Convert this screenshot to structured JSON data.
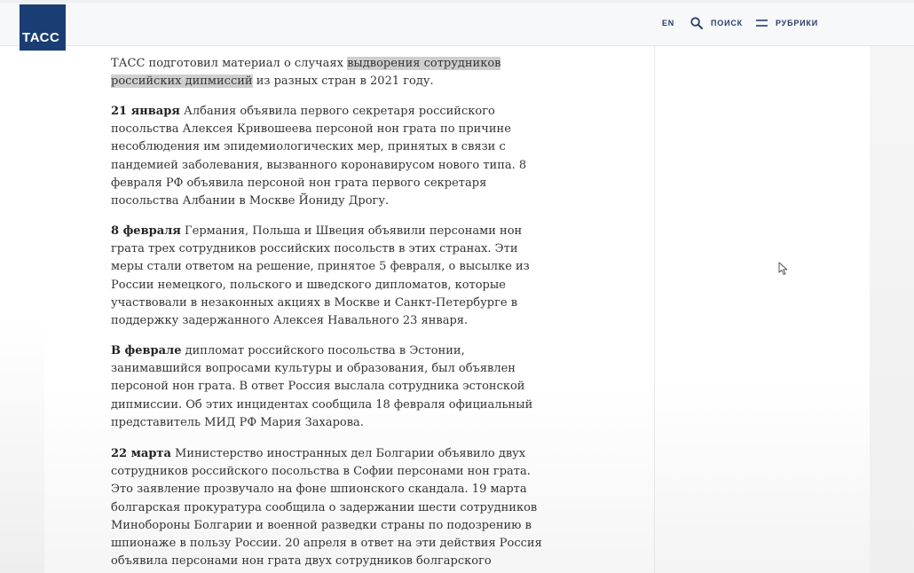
{
  "header": {
    "logo_text": "ТАСС",
    "nav": {
      "lang": "EN",
      "search_label": "ПОИСК",
      "rubrics_label": "РУБРИКИ"
    }
  },
  "article": {
    "intro": {
      "before": "ТАСС подготовил материал о случаях ",
      "highlight": "выдворения сотрудников российских дипмиссий",
      "after": " из разных стран в 2021 году."
    },
    "paragraphs": [
      {
        "date": "21 января",
        "text": " Албания объявила первого секретаря российского посольства Алексея Кривошеева персоной нон грата по причине несоблюдения им эпидемиологических мер, принятых в связи с пандемией заболевания, вызванного коронавирусом нового типа. 8 февраля РФ объявила персоной нон грата первого секретаря посольства Албании в Москве Йониду Дрогу."
      },
      {
        "date": "8 февраля",
        "text": " Германия, Польша и Швеция объявили персонами нон грата трех сотрудников российских посольств в этих странах. Эти меры стали ответом на решение, принятое 5 февраля, о высылке из России немецкого, польского и шведского дипломатов, которые участвовали в незаконных акциях в Москве и Санкт-Петербурге в поддержку задержанного Алексея Навального 23 января."
      },
      {
        "date": "В феврале",
        "text": " дипломат российского посольства в Эстонии, занимавшийся вопросами культуры и образования, был объявлен персоной нон грата. В ответ Россия выслала сотрудника эстонской дипмиссии. Об этих инцидентах сообщила 18 февраля официальный представитель МИД РФ Мария Захарова."
      },
      {
        "date": "22 марта",
        "text": " Министерство иностранных дел Болгарии объявило двух сотрудников российского посольства в Софии персонами нон грата. Это заявление прозвучало на фоне шпионского скандала. 19 марта болгарская прокуратура сообщила о задержании шести сотрудников Минобороны Болгарии и военной разведки страны по подозрению в шпионаже в пользу России. 20 апреля в ответ на эти действия Россия объявила персонами нон грата двух сотрудников болгарского посольства"
      }
    ]
  },
  "icons": {
    "search": "search-icon",
    "menu": "menu-icon",
    "cursor": "mouse-cursor-icon"
  },
  "colors": {
    "brand": "#1a3e73",
    "nav_text": "#2a3d66",
    "body_text": "#333333",
    "highlight": "#cfcfcf"
  }
}
